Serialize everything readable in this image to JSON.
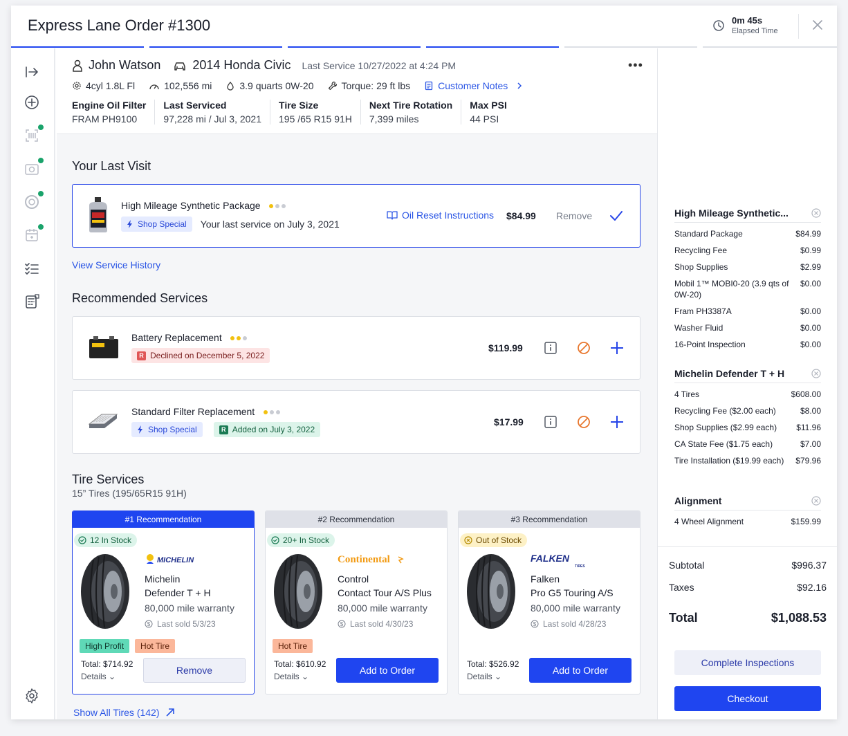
{
  "header": {
    "title": "Express Lane Order #1300",
    "elapsed_value": "0m 45s",
    "elapsed_label": "Elapsed Time"
  },
  "progress": {
    "completed_steps": 4,
    "total_steps": 6
  },
  "customer": {
    "name": "John Watson",
    "vehicle": "2014 Honda Civic",
    "last_service": "Last Service 10/27/2022 at 4:24 PM",
    "engine": "4cyl 1.8L Fl",
    "mileage": "102,556 mi",
    "oil": "3.9 quarts 0W-20",
    "torque": "Torque: 29 ft lbs",
    "notes_link": "Customer Notes",
    "specs": [
      {
        "label": "Engine Oil Filter",
        "value": "FRAM PH9100"
      },
      {
        "label": "Last Serviced",
        "value": "97,228 mi / Jul 3, 2021"
      },
      {
        "label": "Tire Size",
        "value": "195 /65 R15 91H"
      },
      {
        "label": "Next Tire Rotation",
        "value": "7,399 miles"
      },
      {
        "label": "Max PSI",
        "value": "44 PSI"
      }
    ]
  },
  "last_visit": {
    "title": "Your Last Visit",
    "service": "High Mileage Synthetic Package",
    "rating": 1,
    "tag": "Shop Special",
    "note": "Your last service on July 3, 2021",
    "instructions": "Oil Reset Instructions",
    "price": "$84.99",
    "remove": "Remove",
    "history_link": "View Service History"
  },
  "recommended": {
    "title": "Recommended Services",
    "items": [
      {
        "name": "Battery Replacement",
        "rating": 2,
        "tag": "Declined on December 5, 2022",
        "price": "$119.99"
      },
      {
        "name": "Standard Filter Replacement",
        "rating": 1,
        "tag_special": "Shop Special",
        "tag": "Added on July 3, 2022",
        "price": "$17.99"
      }
    ]
  },
  "tires": {
    "title": "Tire Services",
    "subtitle": "15” Tires (195/65R15 91H)",
    "show_all": "Show All Tires (142)",
    "cards": [
      {
        "rank": "#1 Recommendation",
        "stock": "12 In Stock",
        "brand": "MICHELIN",
        "line1": "Michelin",
        "line2": "Defender T + H",
        "warranty": "80,000 mile warranty",
        "last_sold": "Last sold 5/3/23",
        "pills": [
          "High Profit",
          "Hot Tire"
        ],
        "total": "Total: $714.92",
        "details": "Details",
        "action": "Remove"
      },
      {
        "rank": "#2 Recommendation",
        "stock": "20+ In Stock",
        "brand": "Continental",
        "line1": "Control",
        "line2": "Contact Tour A/S Plus",
        "warranty": "80,000 mile warranty",
        "last_sold": "Last sold 4/30/23",
        "pills": [
          "Hot Tire"
        ],
        "total": "Total: $610.92",
        "details": "Details",
        "action": "Add to Order"
      },
      {
        "rank": "#3 Recommendation",
        "stock": "Out of Stock",
        "brand": "FALKEN",
        "line1": "Falken",
        "line2": "Pro G5 Touring A/S",
        "warranty": "80,000 mile warranty",
        "last_sold": "Last sold 4/28/23",
        "pills": [],
        "total": "Total: $526.92",
        "details": "Details",
        "action": "Add to Order"
      }
    ]
  },
  "order": {
    "groups": [
      {
        "title": "High Mileage Synthetic...",
        "items": [
          {
            "name": "Standard Package",
            "price": "$84.99"
          },
          {
            "name": "Recycling Fee",
            "price": "$0.99"
          },
          {
            "name": "Shop Supplies",
            "price": "$2.99"
          },
          {
            "name": "Mobil 1™ MOBI0-20 (3.9 qts of 0W-20)",
            "price": "$0.00"
          },
          {
            "name": "Fram PH3387A",
            "price": "$0.00"
          },
          {
            "name": "Washer Fluid",
            "price": "$0.00"
          },
          {
            "name": "16-Point Inspection",
            "price": "$0.00"
          }
        ]
      },
      {
        "title": "Michelin Defender T + H",
        "items": [
          {
            "name": "4 Tires",
            "price": "$608.00"
          },
          {
            "name": "Recycling Fee ($2.00 each)",
            "price": "$8.00"
          },
          {
            "name": "Shop Supplies ($2.99 each)",
            "price": "$11.96"
          },
          {
            "name": "CA State Fee ($1.75 each)",
            "price": "$7.00"
          },
          {
            "name": "Tire Installation ($19.99 each)",
            "price": "$79.96"
          }
        ]
      },
      {
        "title": "Alignment",
        "items": [
          {
            "name": "4 Wheel Alignment",
            "price": "$159.99"
          }
        ]
      }
    ],
    "subtotal_label": "Subtotal",
    "subtotal": "$996.37",
    "taxes_label": "Taxes",
    "taxes": "$92.16",
    "total_label": "Total",
    "total": "$1,088.53",
    "complete_btn": "Complete Inspections",
    "checkout_btn": "Checkout"
  },
  "colors": {
    "accent": "#1f45f0",
    "link": "#2a55e5",
    "success": "#1aa36b",
    "decline": "#e8772e"
  }
}
